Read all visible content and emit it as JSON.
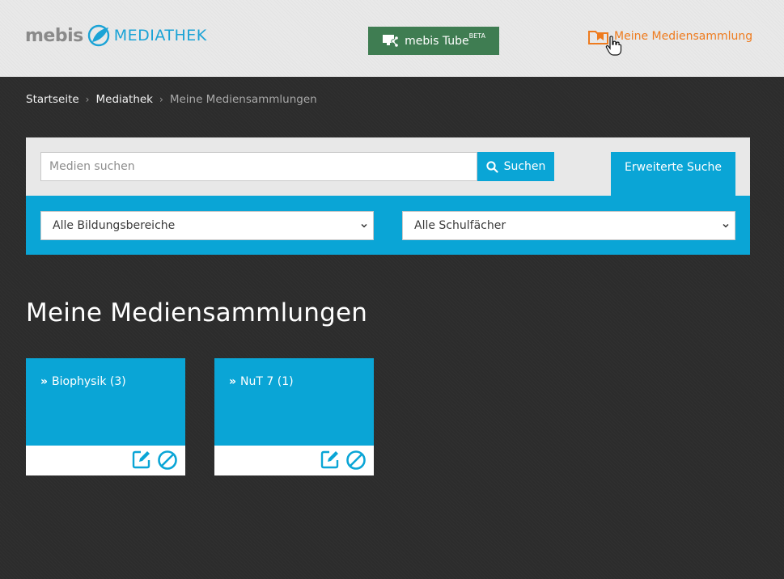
{
  "header": {
    "logo_brand": "mebis",
    "logo_product": "MEDIATHEK",
    "tube_label": "mebis Tube",
    "tube_badge": "BETA",
    "collection_link": "Meine Mediensammlung"
  },
  "breadcrumb": {
    "items": [
      "Startseite",
      "Mediathek"
    ],
    "current": "Meine Mediensammlungen"
  },
  "search": {
    "placeholder": "Medien suchen",
    "button_label": "Suchen",
    "advanced_label": "Erweiterte Suche",
    "filter_education": "Alle Bildungsbereiche",
    "filter_subject": "Alle Schulfächer"
  },
  "main": {
    "title": "Meine Mediensammlungen",
    "collections": [
      {
        "label": "Biophysik (3)"
      },
      {
        "label": "NuT 7 (1)"
      }
    ]
  },
  "icons": {
    "tube": "share-screen-icon",
    "collection": "folder-bookmark-icon",
    "search": "search-icon",
    "chevron": "chevron-down-icon",
    "edit": "edit-icon",
    "delete": "ban-icon"
  },
  "colors": {
    "accent_blue": "#0aa5d6",
    "tube_green": "#3f7d52",
    "link_orange": "#ee7b1e",
    "background": "#2c2c2c",
    "header_bg": "#e9e9e9"
  }
}
